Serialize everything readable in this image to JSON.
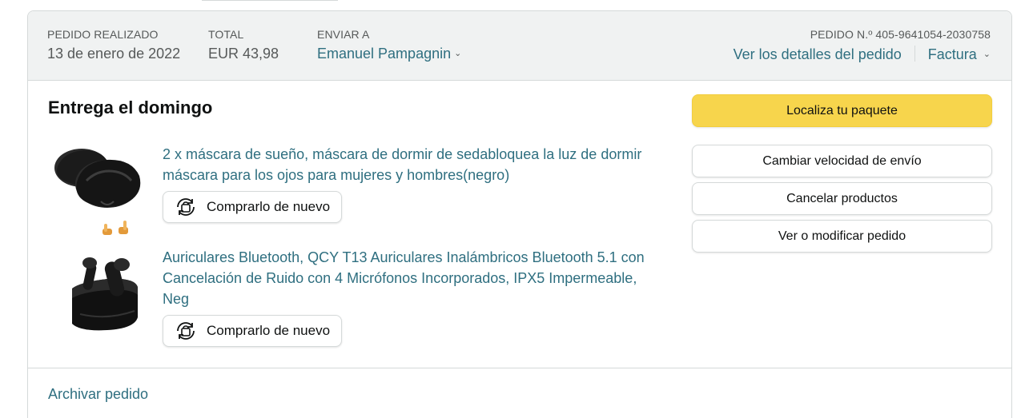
{
  "header": {
    "order_placed_label": "PEDIDO REALIZADO",
    "order_placed_value": "13 de enero de 2022",
    "total_label": "TOTAL",
    "total_value": "EUR 43,98",
    "ship_to_label": "ENVIAR A",
    "ship_to_value": "Emanuel Pampagnin",
    "order_number": "PEDIDO N.º 405-9641054-2030758",
    "order_details_link": "Ver los detalles del pedido",
    "invoice_link": "Factura"
  },
  "delivery": {
    "title": "Entrega el domingo"
  },
  "items": [
    {
      "title": "2 x máscara de sueño, máscara de dormir de sedabloquea la luz de dormir máscara para los ojos para mujeres y hombres(negro)",
      "buy_again_label": "Comprarlo de nuevo",
      "icon": "sleep-mask-product-icon"
    },
    {
      "title": "Auriculares Bluetooth, QCY T13 Auriculares Inalámbricos Bluetooth 5.1 con Cancelación de Ruido con 4 Micrófonos Incorporados, IPX5 Impermeable, Neg",
      "buy_again_label": "Comprarlo de nuevo",
      "icon": "earbuds-product-icon"
    }
  ],
  "actions": {
    "track_package": "Localiza tu paquete",
    "change_speed": "Cambiar velocidad de envío",
    "cancel_items": "Cancelar productos",
    "view_modify": "Ver o modificar pedido"
  },
  "footer": {
    "archive_link": "Archivar pedido"
  },
  "colors": {
    "link": "#2f6f80",
    "primary_button": "#f7d54c",
    "header_bg": "#f0f2f2",
    "border": "#d5d9d9"
  }
}
